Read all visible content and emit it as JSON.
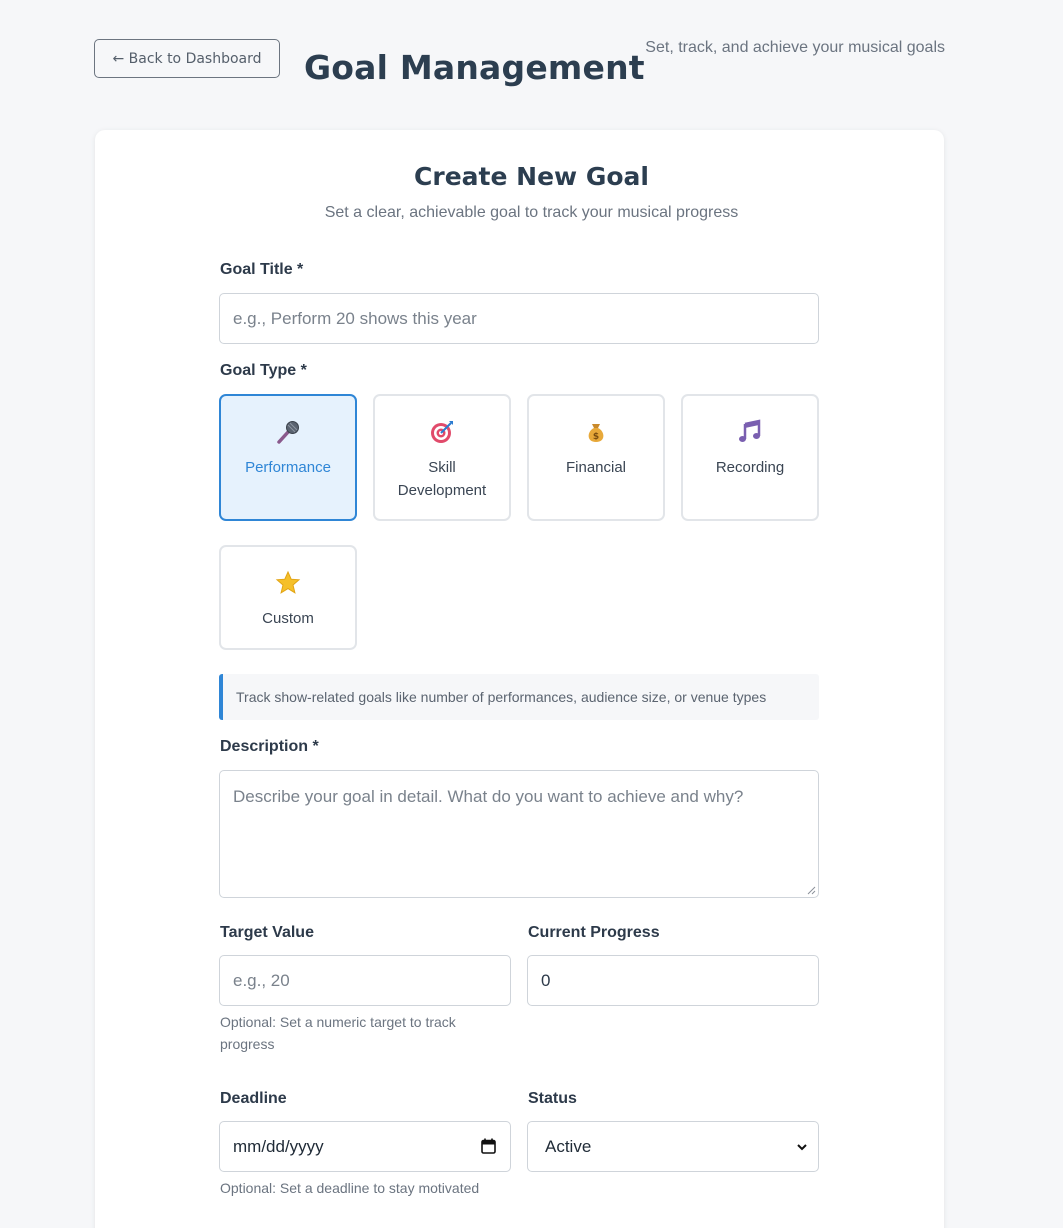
{
  "header": {
    "back_label": "← Back to Dashboard",
    "title": "Goal Management",
    "subtitle": "Set, track, and achieve your musical goals"
  },
  "form": {
    "title": "Create New Goal",
    "subtitle": "Set a clear, achievable goal to track your musical progress",
    "goal_title": {
      "label": "Goal Title *",
      "placeholder": "e.g., Perform 20 shows this year",
      "value": ""
    },
    "goal_type": {
      "label": "Goal Type *",
      "options": [
        {
          "label": "Performance",
          "icon": "microphone-icon",
          "selected": true
        },
        {
          "label": "Skill Development",
          "icon": "target-icon",
          "selected": false
        },
        {
          "label": "Financial",
          "icon": "money-bag-icon",
          "selected": false
        },
        {
          "label": "Recording",
          "icon": "music-note-icon",
          "selected": false
        },
        {
          "label": "Custom",
          "icon": "star-icon",
          "selected": false
        }
      ],
      "hint": "Track show-related goals like number of performances, audience size, or venue types"
    },
    "description": {
      "label": "Description *",
      "placeholder": "Describe your goal in detail. What do you want to achieve and why?"
    },
    "target_value": {
      "label": "Target Value",
      "placeholder": "e.g., 20",
      "help": "Optional: Set a numeric target to track progress"
    },
    "current_progress": {
      "label": "Current Progress",
      "value": "0"
    },
    "deadline": {
      "label": "Deadline",
      "placeholder": "mm/dd/yyyy",
      "help": "Optional: Set a deadline to stay motivated"
    },
    "status": {
      "label": "Status",
      "value": "Active"
    }
  },
  "colors": {
    "accent": "#2f86d6",
    "selected_bg": "#e6f2fd",
    "page_bg": "#f6f7f9",
    "title": "#2c3e50"
  }
}
